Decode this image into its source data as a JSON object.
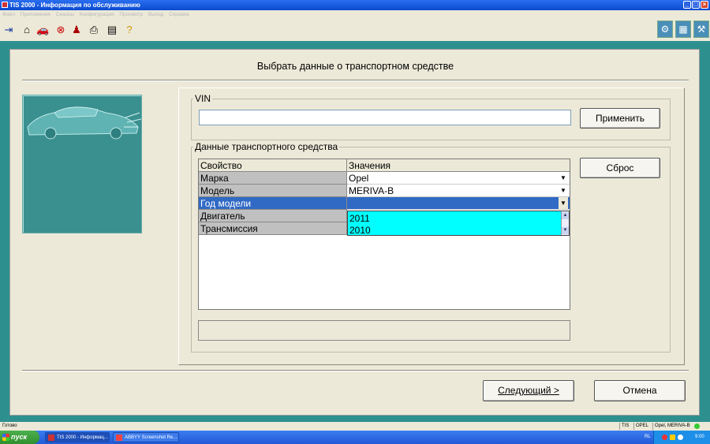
{
  "window": {
    "title": "TIS 2000 - Информация по обслуживанию",
    "minimize_label": "_",
    "maximize_label": "□",
    "close_label": "×"
  },
  "menu": [
    "Файл",
    "Приложения",
    "Сеансы",
    "Конфигурация",
    "Просмотр",
    "Выход",
    "Справка"
  ],
  "toolbar": {
    "icons": [
      "exit-door-icon",
      "home-icon",
      "car-icon",
      "stop-icon",
      "person-icon",
      "print-icon",
      "notebook-icon",
      "help-icon",
      "diagnostic-icon",
      "vehicle-data-icon",
      "car-service-icon"
    ]
  },
  "page": {
    "title": "Выбрать данные о транспортном средстве"
  },
  "vin": {
    "legend": "VIN",
    "value": "",
    "apply_label": "Применить"
  },
  "vehicle": {
    "legend": "Данные транспортного средства",
    "reset_label": "Сброс",
    "headers": {
      "property": "Свойство",
      "value": "Значения"
    },
    "rows": [
      {
        "property": "Марка",
        "value": "Opel"
      },
      {
        "property": "Модель",
        "value": "MERIVA-B"
      },
      {
        "property": "Год модели",
        "value": ""
      },
      {
        "property": "Двигатель",
        "value": ""
      },
      {
        "property": "Трансмиссия",
        "value": ""
      }
    ],
    "dropdown_options": [
      "2011",
      "2010"
    ]
  },
  "buttons": {
    "next_label": "Следующий >",
    "cancel_label": "Отмена"
  },
  "statusbar": {
    "status": "Готово",
    "cells": [
      "TIS",
      "OPEL",
      "Opel, MERIVA-B"
    ]
  },
  "taskbar": {
    "start_label": "пуск",
    "items": [
      "TIS 2000 - Информац...",
      "ABBYY Screenshot Re..."
    ],
    "lang": "RL",
    "clock": "9:00"
  },
  "colors": {
    "teal": "#2e8f8f",
    "selection": "#316ac5",
    "dropdown_bg": "#00ffff"
  }
}
